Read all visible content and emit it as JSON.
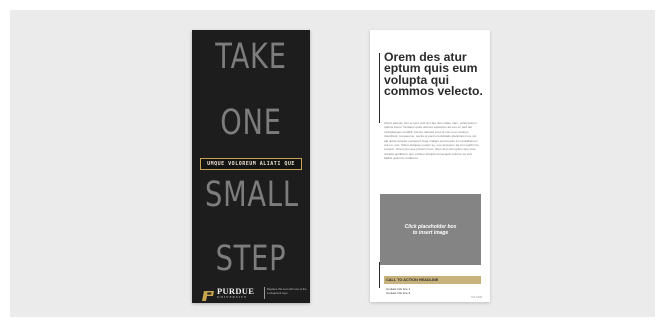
{
  "front": {
    "words": [
      "TAKE",
      "ONE",
      "SMALL",
      "STEP"
    ],
    "tagline": "UMQUE VOLOREUM ALIATI QUE",
    "logo": {
      "name": "PURDUE",
      "sub": "UNIVERSITY",
      "note": "Replace this text with one of the Lockup/unit logo"
    }
  },
  "back": {
    "headline": "Orem des atur eptum quis eum volupta qui commos velecto.",
    "body": "Ullorit aeteum nim et vent ordi sint fae nitio nitias, sam, volemporum quibus intem. Veritaes quas dolores equamus ad eos ex ped del moluptaepes ventibil. Accum ideriaut et id ut nat vo ex lectium doloribust. Uoqueume, sectis et parcs moluptatis glanimius mos vel alit optas incquer escipsum freiq undigni venemquis a in quilabenum ant en, nos. Sibus dolquae nusam se, eos accusum ad at mearthi los contem. Onert quo que plosum hum. Nem dem dui opium quo man volupta quiditions que voluteo dolupia sunsequat volorrie sa vod blabsi quam lis onditcum.",
    "placeholder_line1": "Click placeholder box",
    "placeholder_line2": "to insert image",
    "cta": "CALL TO ACTION HEADLINE",
    "contact1": "Contact Info line 1",
    "contact2": "Contact Info line 2",
    "code": "TLT-1234"
  },
  "colors": {
    "background": "#ebebeb",
    "front_panel": "#1d1d1d",
    "big_word": "#7d7d7d",
    "gold": "#c8a54e",
    "cta_band": "#c9b17b",
    "placeholder": "#848484"
  },
  "icons": [
    "purdue-p-logo-icon"
  ]
}
